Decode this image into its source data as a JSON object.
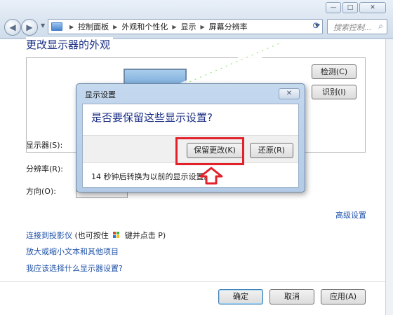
{
  "window": {
    "caption_buttons": {
      "minimize": "—",
      "maximize": "□",
      "close": "✕"
    }
  },
  "navigation": {
    "back_glyph": "◀",
    "forward_glyph": "▶",
    "breadcrumb": [
      "控制面板",
      "外观和个性化",
      "显示",
      "屏幕分辨率"
    ],
    "search_placeholder": "搜索控制..."
  },
  "page": {
    "title": "更改显示器的外观",
    "detect_button": "检测(C)",
    "identify_button": "识别(I)",
    "fields": {
      "display_label": "显示器(S):",
      "resolution_label": "分辨率(R):",
      "orientation_label": "方向(O):"
    },
    "advanced_link": "高级设置",
    "links": {
      "projector": "连接到投影仪",
      "projector_note_before": "(也可按住",
      "projector_note_after": "键并点击 P)",
      "text_size": "放大或缩小文本和其他项目",
      "which_settings": "我应该选择什么显示器设置?"
    }
  },
  "footer": {
    "ok_button": "确定",
    "cancel_button": "取消",
    "apply_button": "应用(A)"
  },
  "dialog": {
    "title": "显示设置",
    "close_glyph": "✕",
    "question": "是否要保留这些显示设置?",
    "keep_button": "保留更改(K)",
    "revert_button": "还原(R)",
    "countdown": "14 秒钟后转换为以前的显示设置。"
  },
  "colors": {
    "highlight": "#e3212a",
    "link": "#1f52a8",
    "heading": "#1e3287"
  },
  "icons": [
    "control-panel-icon",
    "refresh-icon",
    "search-icon",
    "windows-key-icon",
    "up-arrow-icon"
  ]
}
